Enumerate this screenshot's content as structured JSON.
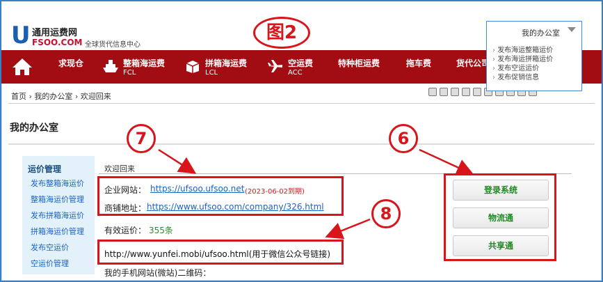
{
  "logo": {
    "letter": "U",
    "name_cn": "通用运费网",
    "name_en": "FSOO.COM",
    "tagline": "全球货代信息中心"
  },
  "figure_label": "图2",
  "office_dropdown": {
    "label": "我的办公室",
    "items": [
      "发布海运整箱运价",
      "发布海运拼箱运价",
      "发布空运运价",
      "发布促销信息"
    ]
  },
  "nav": {
    "items": [
      {
        "cn": "求现仓",
        "en": ""
      },
      {
        "cn": "整箱海运费",
        "en": "FCL"
      },
      {
        "cn": "拼箱海运费",
        "en": "LCL"
      },
      {
        "cn": "空运费",
        "en": "ACC"
      },
      {
        "cn": "特种柜运费",
        "en": ""
      },
      {
        "cn": "拖车费",
        "en": ""
      },
      {
        "cn": "货代公司",
        "en": ""
      }
    ]
  },
  "breadcrumb": "首页 › 我的办公室 › 欢迎回来",
  "page_title": "我的办公室",
  "sidebar": {
    "heading": "运价管理",
    "links": [
      "发布整箱海运价",
      "整箱海运价管理",
      "发布拼箱海运价",
      "拼箱海运价管理",
      "发布空运价",
      "空运价管理"
    ]
  },
  "main": {
    "welcome": "欢迎回来",
    "site_label": "企业网站：",
    "site_url": "https://ufsoo.ufsoo.net",
    "site_expire": "(2023-06-02到期)",
    "shop_label": "商铺地址：",
    "shop_url": "https://www.ufsoo.com/company/326.html",
    "rates_label": "有效运价：",
    "rates_count": "355条",
    "mobile_url": "http://www.yunfei.mobi/ufsoo.html(用于微信公众号链接)",
    "qr_label": "我的手机网站(微站)二维码："
  },
  "buttons": {
    "login": "登录系统",
    "logistics": "物流通",
    "share": "共享通"
  },
  "annotations": {
    "n7": "7",
    "n6": "6",
    "n8": "8"
  },
  "colors": {
    "nav_bg": "#a10d12",
    "annotation_red": "#d7151b",
    "link_blue": "#1b63c2",
    "button_green": "#208a25"
  }
}
